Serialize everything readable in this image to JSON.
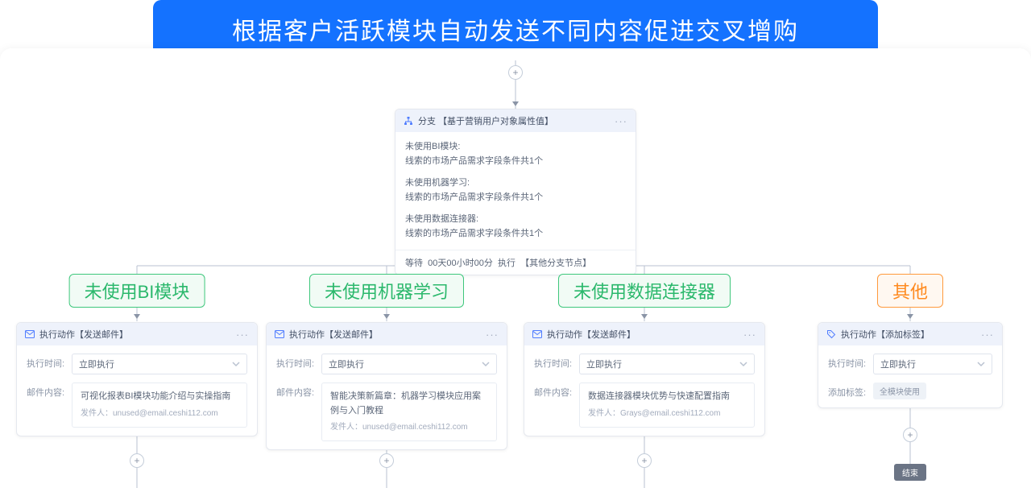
{
  "banner": "根据客户活跃模块自动发送不同内容促进交叉增购",
  "branch": {
    "title": "分支 【基于营销用户对象属性值】",
    "segments": [
      {
        "h": "未使用BI模块:",
        "d": "线索的市场产品需求字段条件共1个"
      },
      {
        "h": "未使用机器学习:",
        "d": "线索的市场产品需求字段条件共1个"
      },
      {
        "h": "未使用数据连接器:",
        "d": "线索的市场产品需求字段条件共1个"
      }
    ],
    "footer_wait": "等待",
    "footer_time": "00天00小时00分",
    "footer_run": "执行",
    "footer_target": "【其他分支节点】"
  },
  "tags": {
    "a": "未使用BI模块",
    "b": "未使用机器学习",
    "c": "未使用数据连接器",
    "d": "其他"
  },
  "labels": {
    "action_mail": "执行动作【发送邮件】",
    "action_tag": "执行动作【添加标签】",
    "exec_time": "执行时间:",
    "mail_content": "邮件内容:",
    "add_tag": "添加标签:",
    "immediate": "立即执行",
    "sender_prefix": "发件人：",
    "end": "结束"
  },
  "cards": {
    "a": {
      "subject": "可视化报表BI模块功能介绍与实操指南",
      "sender": "unused@email.ceshi112.com"
    },
    "b": {
      "subject": "智能决策新篇章：机器学习模块应用案例与入门教程",
      "sender": "unused@email.ceshi112.com"
    },
    "c": {
      "subject": "数据连接器模块优势与快速配置指南",
      "sender": "Grays@email.ceshi112.com"
    },
    "d": {
      "tag_value": "全模块使用"
    }
  }
}
